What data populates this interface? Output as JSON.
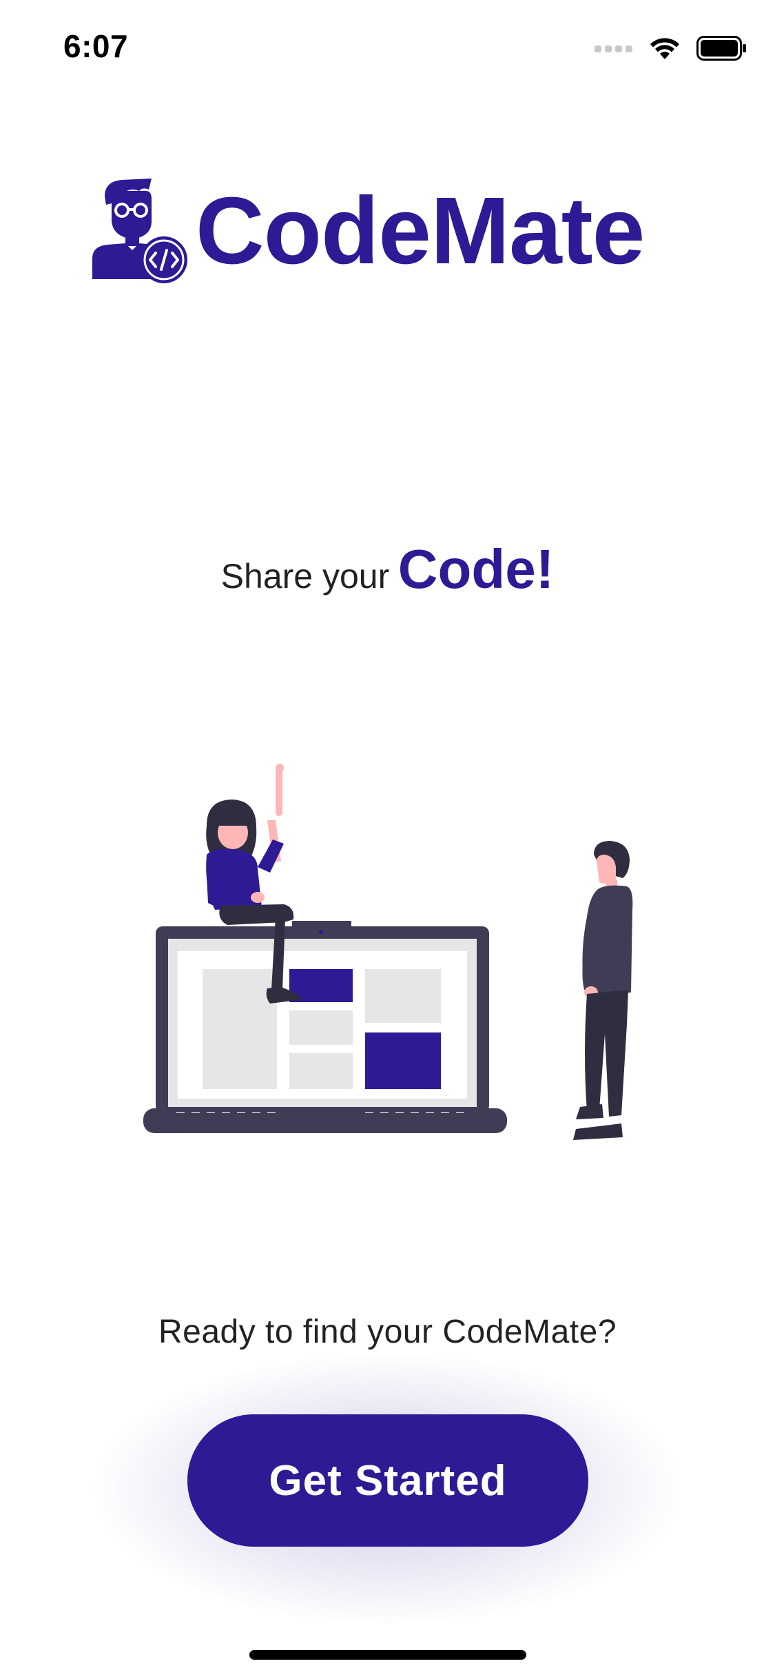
{
  "status_bar": {
    "time": "6:07",
    "icons": [
      "cellular-signal-icon",
      "wifi-icon",
      "battery-icon"
    ]
  },
  "app": {
    "name": "CodeMate",
    "logo_icon": "developer-avatar-code-icon"
  },
  "tagline": {
    "prefix": "Share your",
    "highlight": "Code!"
  },
  "illustration": {
    "name": "two-people-with-laptop-illustration"
  },
  "prompt": "Ready to find your CodeMate?",
  "cta": {
    "label": "Get Started"
  },
  "colors": {
    "brand": "#2e1a94",
    "text": "#222222",
    "background": "#ffffff",
    "laptop_frame": "#3f3d56",
    "placeholder": "#e6e6e6"
  }
}
